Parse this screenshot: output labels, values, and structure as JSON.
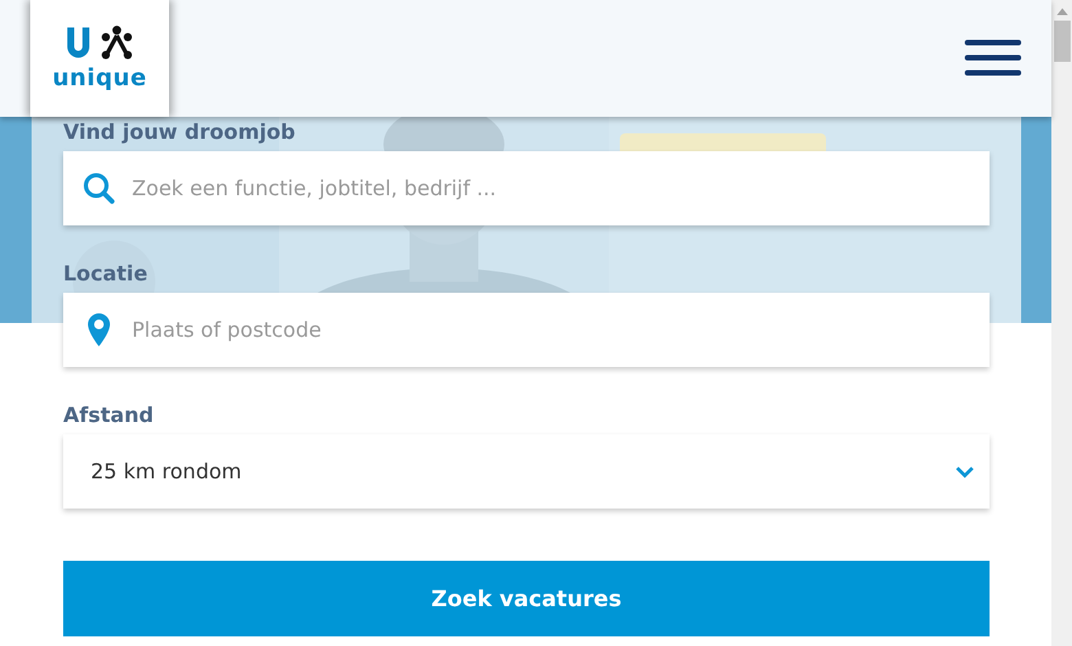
{
  "header": {
    "logo_text": "unique"
  },
  "search": {
    "label": "Vind jouw droomjob",
    "placeholder": "Zoek een functie, jobtitel, bedrijf ..."
  },
  "location": {
    "label": "Locatie",
    "placeholder": "Plaats of postcode"
  },
  "distance": {
    "label": "Afstand",
    "value": "25 km rondom"
  },
  "submit": {
    "label": "Zoek vacatures"
  }
}
